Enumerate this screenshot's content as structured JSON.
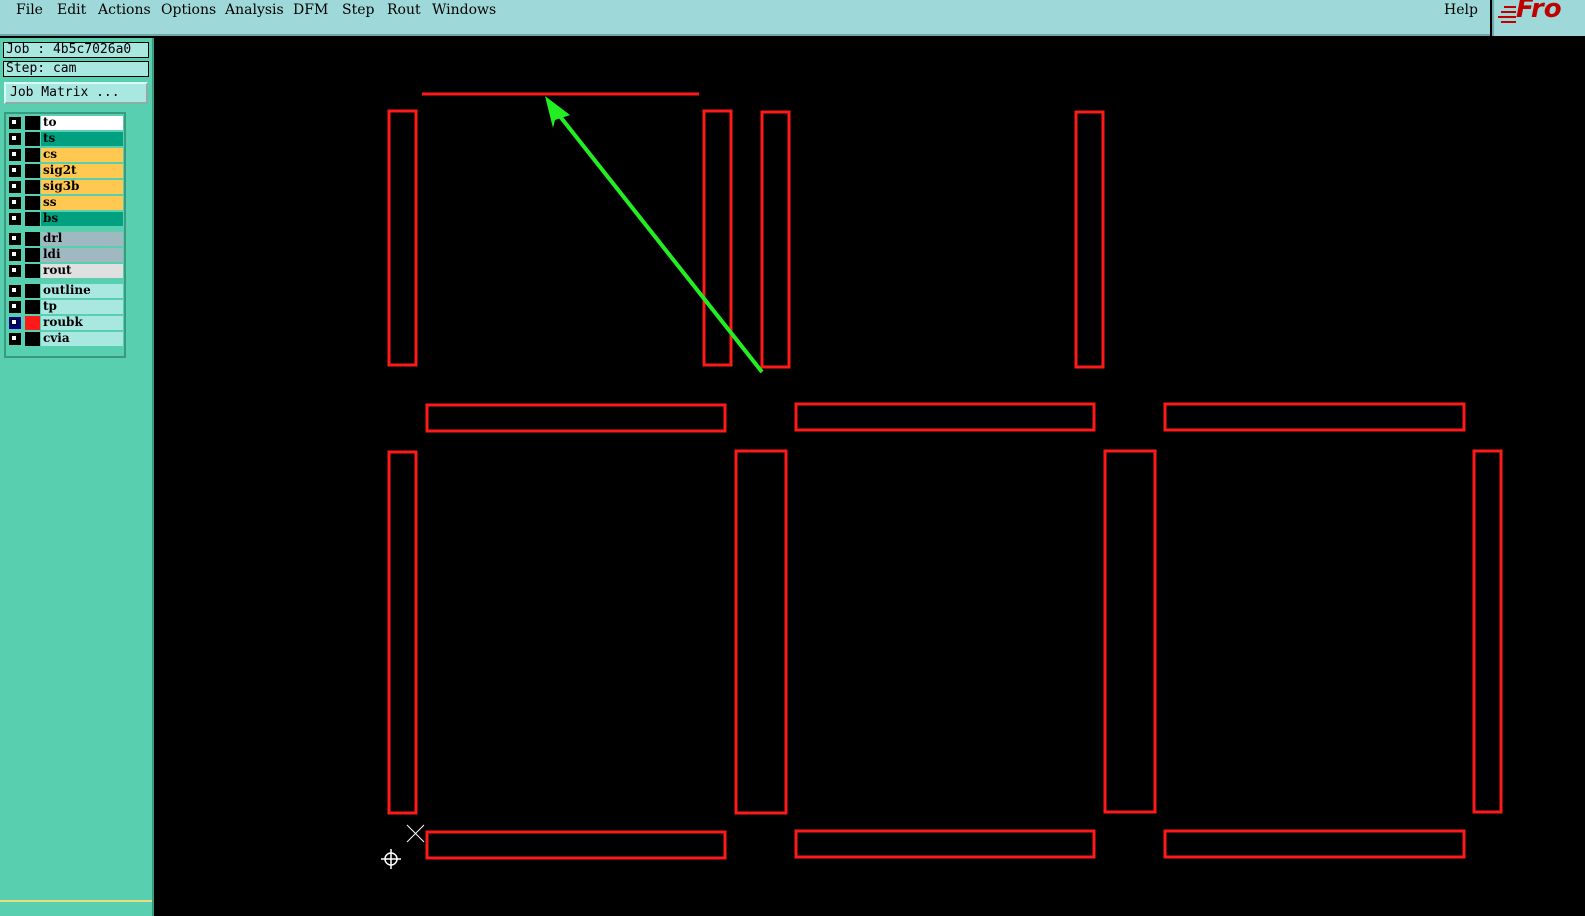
{
  "menubar": {
    "items": [
      "File",
      "Edit",
      "Actions",
      "Options",
      "Analysis",
      "DFM",
      "Step",
      "Rout",
      "Windows"
    ],
    "help": "Help",
    "logo": "Fro"
  },
  "job": {
    "label": "Job : 4b5c7026a0",
    "step": "Step: cam",
    "matrix_button": "Job Matrix ..."
  },
  "layers": [
    {
      "name": "to",
      "color": "#ffffff"
    },
    {
      "name": "ts",
      "color": "#00a080"
    },
    {
      "name": "cs",
      "color": "#ffc850"
    },
    {
      "name": "sig2t",
      "color": "#ffc850"
    },
    {
      "name": "sig3b",
      "color": "#ffc850"
    },
    {
      "name": "ss",
      "color": "#ffc850"
    },
    {
      "name": "bs",
      "color": "#00a080"
    },
    {
      "name": "drl",
      "color": "#a0b8c0"
    },
    {
      "name": "ldi",
      "color": "#a0b8c0"
    },
    {
      "name": "rout",
      "color": "#e0e0e0"
    },
    {
      "name": "outline",
      "color": "#a8e8e0"
    },
    {
      "name": "tp",
      "color": "#a8e8e0"
    },
    {
      "name": "roubk",
      "color": "#a8e8e0",
      "active": true
    },
    {
      "name": "cvia",
      "color": "#a8e8e0"
    }
  ],
  "colors": {
    "shape_stroke": "#ff1a1a",
    "arrow": "#22ee22",
    "background": "#000000"
  }
}
